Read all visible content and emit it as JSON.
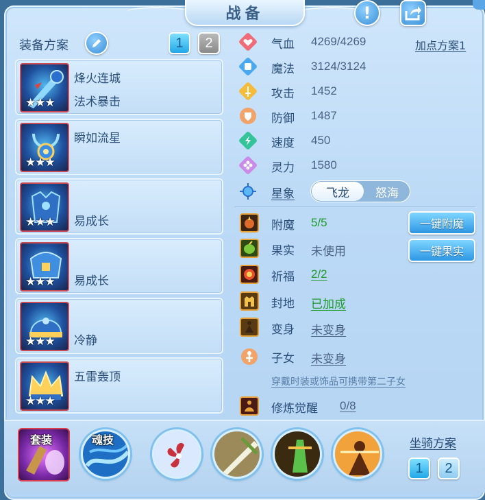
{
  "header": {
    "title": "战备"
  },
  "plan": {
    "label": "装备方案",
    "tab1": "1",
    "tab2": "2"
  },
  "equipment": [
    {
      "line1": "烽火连城",
      "line2": "法术暴击",
      "stars": "★★★"
    },
    {
      "line1": "瞬如流星",
      "line2": "",
      "stars": "★★★"
    },
    {
      "line1": "",
      "line2": "易成长",
      "stars": "★★★"
    },
    {
      "line1": "",
      "line2": "易成长",
      "stars": "★★★"
    },
    {
      "line1": "",
      "line2": "冷静",
      "stars": "★★★"
    },
    {
      "line1": "五雷轰顶",
      "line2": "",
      "stars": "★★★"
    }
  ],
  "stats": {
    "hp_label": "气血",
    "hp_value": "4269/4269",
    "mp_label": "魔法",
    "mp_value": "3124/3124",
    "atk_label": "攻击",
    "atk_value": "1452",
    "def_label": "防御",
    "def_value": "1487",
    "spd_label": "速度",
    "spd_value": "450",
    "spirit_label": "灵力",
    "spirit_value": "1580",
    "point_plan": "加点方案1"
  },
  "constellation": {
    "label": "星象",
    "option_active": "飞龙",
    "option_inactive": "怒海"
  },
  "extras": {
    "enchant_label": "附魔",
    "enchant_value": "5/5",
    "enchant_button": "一键附魔",
    "fruit_label": "果实",
    "fruit_value": "未使用",
    "fruit_button": "一键果实",
    "bless_label": "祈福",
    "bless_value": "2/2",
    "seal_label": "封地",
    "seal_value": "已加成",
    "transform_label": "变身",
    "transform_value": "未变身",
    "child_label": "子女",
    "child_value": "未变身",
    "child_hint": "穿戴时装或饰品可携带第二子女",
    "cultivation_label": "修炼觉醒",
    "cultivation_value": "0/8"
  },
  "bottom": {
    "set_label": "套装",
    "soul_label": "魂技",
    "mount_label": "坐骑方案",
    "mount_tab1": "1",
    "mount_tab2": "2"
  },
  "colors": {
    "panel": "#c4dff7",
    "title_text": "#3a5f88",
    "label_text": "#2c4f7a",
    "value_green": "#1e9a2b",
    "button_blue": "#2d97e4",
    "tab_active": "#22a8e8",
    "tab_inactive": "#8a8a8a"
  }
}
